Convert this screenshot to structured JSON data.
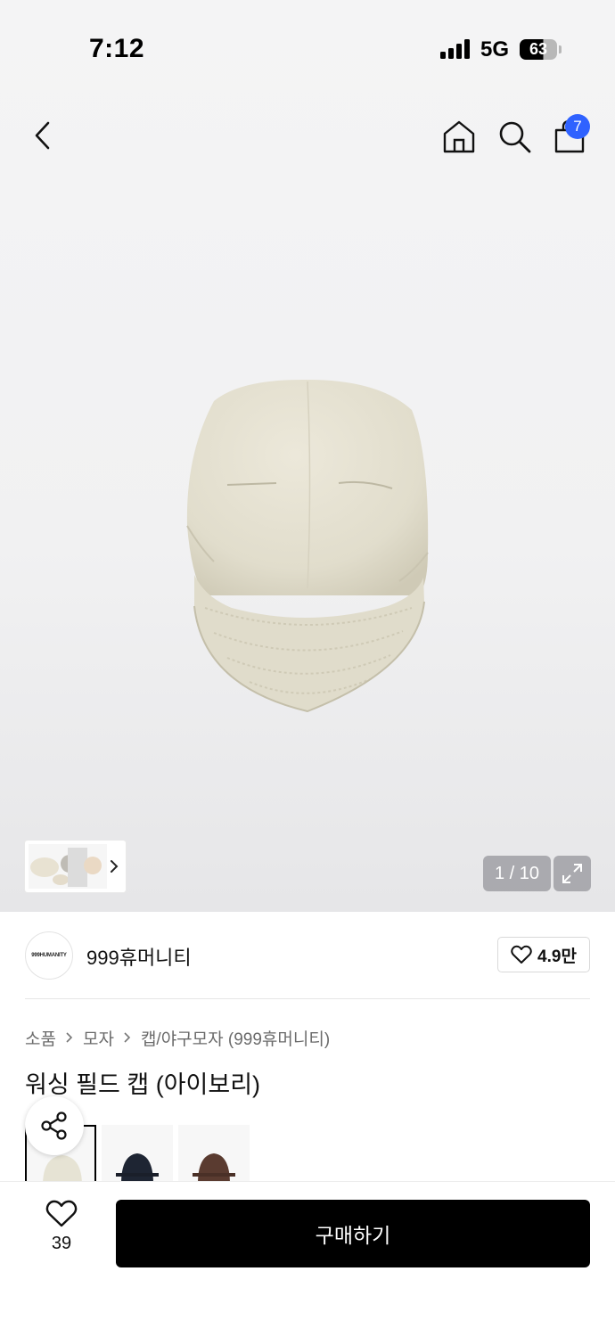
{
  "status_bar": {
    "time": "7:12",
    "network": "5G",
    "battery": "63"
  },
  "nav": {
    "back_icon": "chevron-left-icon",
    "home_icon": "home-icon",
    "search_icon": "search-icon",
    "cart_icon": "shopping-bag-icon",
    "cart_badge": "7",
    "badge_color": "#2f62ff"
  },
  "gallery": {
    "counter": "1 / 10",
    "expand_icon": "expand-icon",
    "product_color": "#e3dfcf"
  },
  "brand": {
    "logo_text": "999HUMANITY",
    "name": "999휴머니티",
    "like_count": "4.9만"
  },
  "breadcrumb": [
    "소품",
    "모자",
    "캡/야구모자 (999휴머니티)"
  ],
  "product": {
    "title": "워싱 필드 캡 (아이보리)"
  },
  "color_options": [
    {
      "name": "ivory",
      "color": "#e6e3d4"
    },
    {
      "name": "navy",
      "color": "#1e2533"
    },
    {
      "name": "brown",
      "color": "#5a3b30"
    }
  ],
  "bottom_bar": {
    "wish_count": "39",
    "buy_label": "구매하기"
  }
}
